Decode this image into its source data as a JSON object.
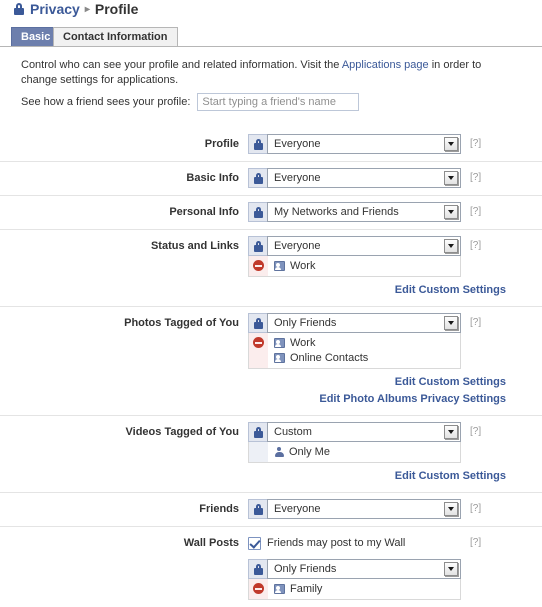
{
  "breadcrumb": {
    "lock_icon": "lock-icon",
    "parent": "Privacy",
    "separator": "▸",
    "current": "Profile"
  },
  "tabs": [
    {
      "label": "Basic",
      "active": true
    },
    {
      "label": "Contact Information",
      "active": false
    }
  ],
  "intro": {
    "text_before": "Control who can see your profile and related information. Visit the ",
    "link": "Applications page",
    "text_after": " in order to change settings for applications."
  },
  "preview": {
    "label": "See how a friend sees your profile:",
    "placeholder": "Start typing a friend's name",
    "value": ""
  },
  "help_label": "[?]",
  "settings": [
    {
      "label": "Profile",
      "lock_icon": "lock-icon",
      "value": "Everyone",
      "help": "[?]"
    },
    {
      "label": "Basic Info",
      "lock_icon": "lock-icon",
      "value": "Everyone",
      "help": "[?]"
    },
    {
      "label": "Personal Info",
      "lock_icon": "lock-icon",
      "value": "My Networks and Friends",
      "help": "[?]"
    },
    {
      "label": "Status and Links",
      "lock_icon": "lock-icon",
      "value": "Everyone",
      "help": "[?]",
      "exclusions": {
        "marker": "deny-icon",
        "items": [
          {
            "icon": "network-group-icon",
            "name": "Work"
          }
        ]
      },
      "links": [
        "Edit Custom Settings"
      ]
    },
    {
      "label": "Photos Tagged of You",
      "lock_icon": "lock-icon",
      "value": "Only Friends",
      "help": "[?]",
      "exclusions": {
        "marker": "deny-icon",
        "items": [
          {
            "icon": "network-group-icon",
            "name": "Work"
          },
          {
            "icon": "network-group-icon",
            "name": "Online Contacts"
          }
        ]
      },
      "links": [
        "Edit Custom Settings",
        "Edit Photo Albums Privacy Settings"
      ]
    },
    {
      "label": "Videos Tagged of You",
      "lock_icon": "lock-icon",
      "value": "Custom",
      "help": "[?]",
      "inclusions": {
        "marker": "none",
        "items": [
          {
            "icon": "person-icon",
            "name": "Only Me"
          }
        ]
      },
      "links": [
        "Edit Custom Settings"
      ]
    },
    {
      "label": "Friends",
      "lock_icon": "lock-icon",
      "value": "Everyone",
      "help": "[?]"
    },
    {
      "label": "Wall Posts",
      "help": "[?]",
      "checkbox": {
        "label": "Friends may post to my Wall",
        "checked": true
      },
      "lock_icon": "lock-icon",
      "value": "Only Friends",
      "exclusions": {
        "marker": "deny-icon",
        "items": [
          {
            "icon": "network-group-icon",
            "name": "Family"
          }
        ]
      }
    }
  ],
  "colors": {
    "brand_blue": "#3b5998",
    "tab_active_bg": "#6d7fad",
    "lock_cell_bg": "#e3e7f0",
    "deny_red": "#c0392b",
    "deny_cell_bg": "#fbeded",
    "link_blue": "#3b5998",
    "help_grey": "#9a9a9a"
  }
}
